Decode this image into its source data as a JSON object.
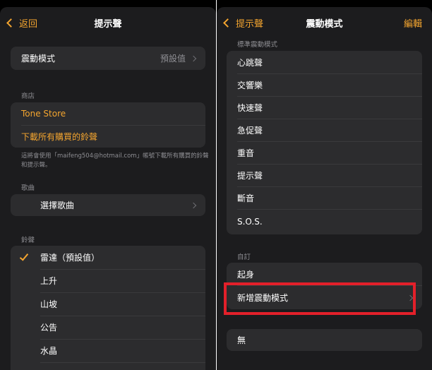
{
  "left": {
    "nav": {
      "back_label": "返回",
      "title": "提示聲"
    },
    "vibration": {
      "label": "震動模式",
      "value": "預設值"
    },
    "store": {
      "header": "商店",
      "tone_store": "Tone Store",
      "download_all": "下載所有購買的鈴聲",
      "footnote": "這將會使用「maifeng504@hotmail.com」帳號下載所有購買的鈴聲和提示聲。"
    },
    "songs": {
      "header": "歌曲",
      "pick_song": "選擇歌曲"
    },
    "ringtones": {
      "header": "鈴聲",
      "items": [
        "雷達（預設值）",
        "上升",
        "山坡",
        "公告",
        "水晶"
      ]
    }
  },
  "right": {
    "nav": {
      "back_label": "提示聲",
      "title": "震動模式",
      "action_label": "編輯"
    },
    "standard": {
      "header": "標準震動模式",
      "items": [
        "心跳聲",
        "交響樂",
        "快速聲",
        "急促聲",
        "重音",
        "提示聲",
        "斷音",
        "S.O.S."
      ]
    },
    "custom": {
      "header": "自訂",
      "items": [
        "起身",
        "新增震動模式"
      ]
    },
    "none_label": "無"
  },
  "colors": {
    "accent": "#f4a52f",
    "highlight": "#e3202a",
    "background": "#1c1c1e",
    "cell": "#2c2c2e"
  }
}
